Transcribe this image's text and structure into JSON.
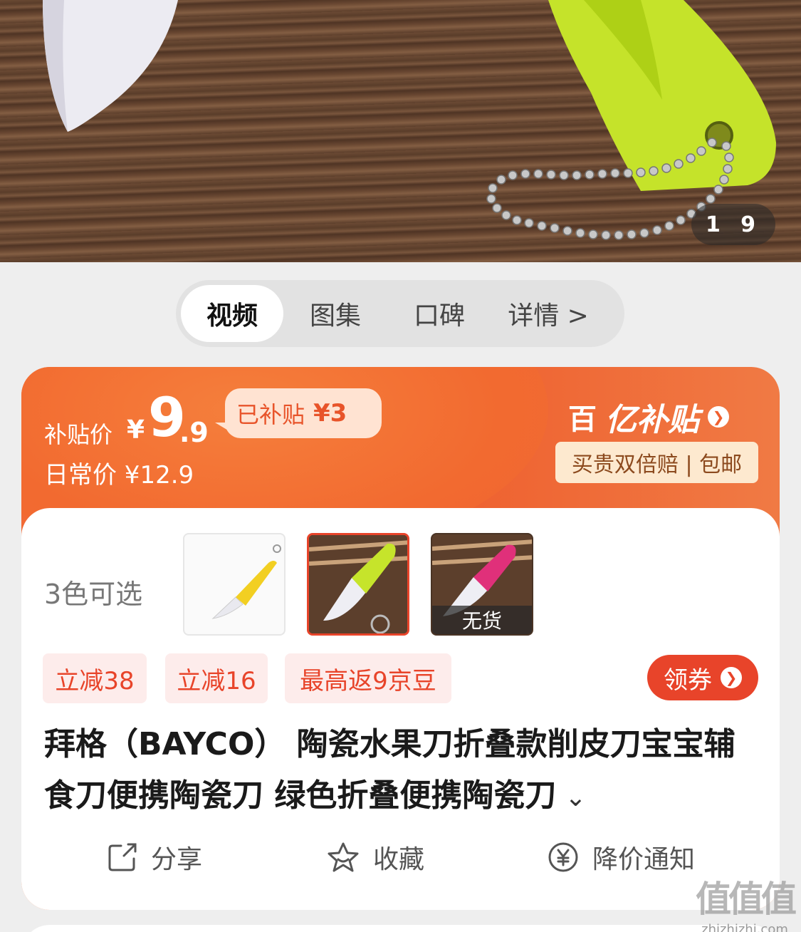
{
  "gallery": {
    "current_page": "1",
    "total_pages": "9"
  },
  "tabs": [
    {
      "label": "视频",
      "active": true
    },
    {
      "label": "图集"
    },
    {
      "label": "口碑"
    },
    {
      "label": "详情 >"
    }
  ],
  "price": {
    "subsidy_label": "补贴价",
    "currency": "¥",
    "subsidy_int": "9",
    "subsidy_dec": ".9",
    "daily_text": "日常价 ¥12.9",
    "subsidy_badge_text": "已补贴",
    "subsidy_badge_amount": "¥3",
    "brand_logo": "百",
    "brand_title": "亿补贴",
    "guarantee_text": "买贵双倍赔 | 包邮",
    "accent_color": "#ee5a2a"
  },
  "variants": {
    "label": "3色可选",
    "items": [
      {
        "color": "yellow",
        "selected": false
      },
      {
        "color": "green",
        "selected": true
      },
      {
        "color": "pink",
        "selected": false,
        "status": "无货"
      }
    ]
  },
  "coupons": [
    "立减38",
    "立减16",
    "最高返9京豆"
  ],
  "get_coupon_label": "领券",
  "product": {
    "title": "拜格（BAYCO） 陶瓷水果刀折叠款削皮刀宝宝辅食刀便携陶瓷刀 绿色折叠便携陶瓷刀"
  },
  "actions": {
    "share": "分享",
    "favorite": "收藏",
    "price_alert": "降价通知"
  },
  "watermark": {
    "big": "值值值",
    "small": "zhizhizhi.com"
  }
}
